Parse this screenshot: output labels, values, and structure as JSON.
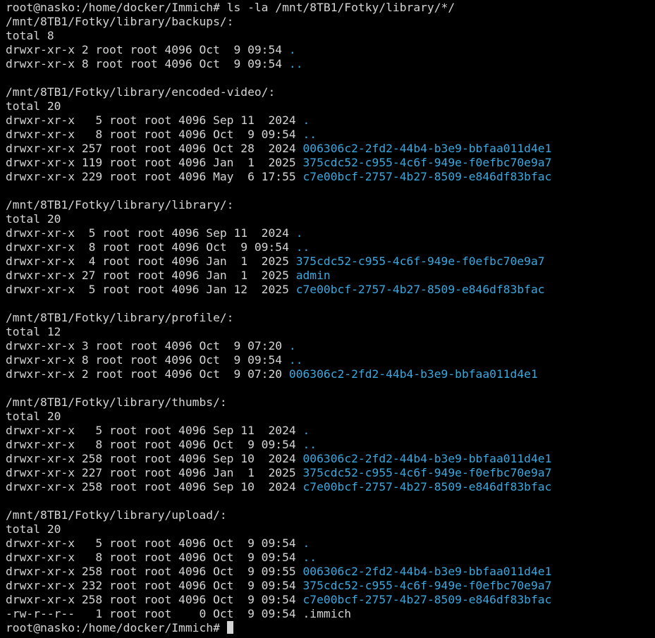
{
  "terminal": {
    "colors": {
      "background": "#000000",
      "text": "#d4d4d4",
      "directory": "#3aa8e0"
    },
    "lines": [
      {
        "kind": "prompt",
        "prompt": "root@nasko:/home/docker/Immich# ",
        "command": "ls -la /mnt/8TB1/Fotky/library/*/"
      },
      {
        "kind": "text",
        "text": "/mnt/8TB1/Fotky/library/backups/:"
      },
      {
        "kind": "text",
        "text": "total 8"
      },
      {
        "kind": "entry",
        "meta": "drwxr-xr-x 2 root root 4096 Oct  9 09:54 ",
        "name": "."
      },
      {
        "kind": "entry",
        "meta": "drwxr-xr-x 8 root root 4096 Oct  9 09:54 ",
        "name": ".."
      },
      {
        "kind": "blank",
        "text": ""
      },
      {
        "kind": "text",
        "text": "/mnt/8TB1/Fotky/library/encoded-video/:"
      },
      {
        "kind": "text",
        "text": "total 20"
      },
      {
        "kind": "entry",
        "meta": "drwxr-xr-x   5 root root 4096 Sep 11  2024 ",
        "name": "."
      },
      {
        "kind": "entry",
        "meta": "drwxr-xr-x   8 root root 4096 Oct  9 09:54 ",
        "name": ".."
      },
      {
        "kind": "entry",
        "meta": "drwxr-xr-x 257 root root 4096 Oct 28  2024 ",
        "name": "006306c2-2fd2-44b4-b3e9-bbfaa011d4e1"
      },
      {
        "kind": "entry",
        "meta": "drwxr-xr-x 119 root root 4096 Jan  1  2025 ",
        "name": "375cdc52-c955-4c6f-949e-f0efbc70e9a7"
      },
      {
        "kind": "entry",
        "meta": "drwxr-xr-x 229 root root 4096 May  6 17:55 ",
        "name": "c7e00bcf-2757-4b27-8509-e846df83bfac"
      },
      {
        "kind": "blank",
        "text": ""
      },
      {
        "kind": "text",
        "text": "/mnt/8TB1/Fotky/library/library/:"
      },
      {
        "kind": "text",
        "text": "total 20"
      },
      {
        "kind": "entry",
        "meta": "drwxr-xr-x  5 root root 4096 Sep 11  2024 ",
        "name": "."
      },
      {
        "kind": "entry",
        "meta": "drwxr-xr-x  8 root root 4096 Oct  9 09:54 ",
        "name": ".."
      },
      {
        "kind": "entry",
        "meta": "drwxr-xr-x  4 root root 4096 Jan  1  2025 ",
        "name": "375cdc52-c955-4c6f-949e-f0efbc70e9a7"
      },
      {
        "kind": "entry",
        "meta": "drwxr-xr-x 27 root root 4096 Jan  1  2025 ",
        "name": "admin"
      },
      {
        "kind": "entry",
        "meta": "drwxr-xr-x  5 root root 4096 Jan 12  2025 ",
        "name": "c7e00bcf-2757-4b27-8509-e846df83bfac"
      },
      {
        "kind": "blank",
        "text": ""
      },
      {
        "kind": "text",
        "text": "/mnt/8TB1/Fotky/library/profile/:"
      },
      {
        "kind": "text",
        "text": "total 12"
      },
      {
        "kind": "entry",
        "meta": "drwxr-xr-x 3 root root 4096 Oct  9 07:20 ",
        "name": "."
      },
      {
        "kind": "entry",
        "meta": "drwxr-xr-x 8 root root 4096 Oct  9 09:54 ",
        "name": ".."
      },
      {
        "kind": "entry",
        "meta": "drwxr-xr-x 2 root root 4096 Oct  9 07:20 ",
        "name": "006306c2-2fd2-44b4-b3e9-bbfaa011d4e1"
      },
      {
        "kind": "blank",
        "text": ""
      },
      {
        "kind": "text",
        "text": "/mnt/8TB1/Fotky/library/thumbs/:"
      },
      {
        "kind": "text",
        "text": "total 20"
      },
      {
        "kind": "entry",
        "meta": "drwxr-xr-x   5 root root 4096 Sep 11  2024 ",
        "name": "."
      },
      {
        "kind": "entry",
        "meta": "drwxr-xr-x   8 root root 4096 Oct  9 09:54 ",
        "name": ".."
      },
      {
        "kind": "entry",
        "meta": "drwxr-xr-x 258 root root 4096 Sep 10  2024 ",
        "name": "006306c2-2fd2-44b4-b3e9-bbfaa011d4e1"
      },
      {
        "kind": "entry",
        "meta": "drwxr-xr-x 227 root root 4096 Jan  1  2025 ",
        "name": "375cdc52-c955-4c6f-949e-f0efbc70e9a7"
      },
      {
        "kind": "entry",
        "meta": "drwxr-xr-x 258 root root 4096 Sep 10  2024 ",
        "name": "c7e00bcf-2757-4b27-8509-e846df83bfac"
      },
      {
        "kind": "blank",
        "text": ""
      },
      {
        "kind": "text",
        "text": "/mnt/8TB1/Fotky/library/upload/:"
      },
      {
        "kind": "text",
        "text": "total 20"
      },
      {
        "kind": "entry",
        "meta": "drwxr-xr-x   5 root root 4096 Oct  9 09:54 ",
        "name": "."
      },
      {
        "kind": "entry",
        "meta": "drwxr-xr-x   8 root root 4096 Oct  9 09:54 ",
        "name": ".."
      },
      {
        "kind": "entry",
        "meta": "drwxr-xr-x 258 root root 4096 Oct  9 09:55 ",
        "name": "006306c2-2fd2-44b4-b3e9-bbfaa011d4e1"
      },
      {
        "kind": "entry",
        "meta": "drwxr-xr-x 232 root root 4096 Oct  9 09:54 ",
        "name": "375cdc52-c955-4c6f-949e-f0efbc70e9a7"
      },
      {
        "kind": "entry",
        "meta": "drwxr-xr-x 258 root root 4096 Oct  9 09:54 ",
        "name": "c7e00bcf-2757-4b27-8509-e846df83bfac"
      },
      {
        "kind": "text",
        "text": "-rw-r--r--   1 root root    0 Oct  9 09:54 .immich"
      },
      {
        "kind": "cursor-prompt",
        "prompt": "root@nasko:/home/docker/Immich# "
      }
    ]
  }
}
